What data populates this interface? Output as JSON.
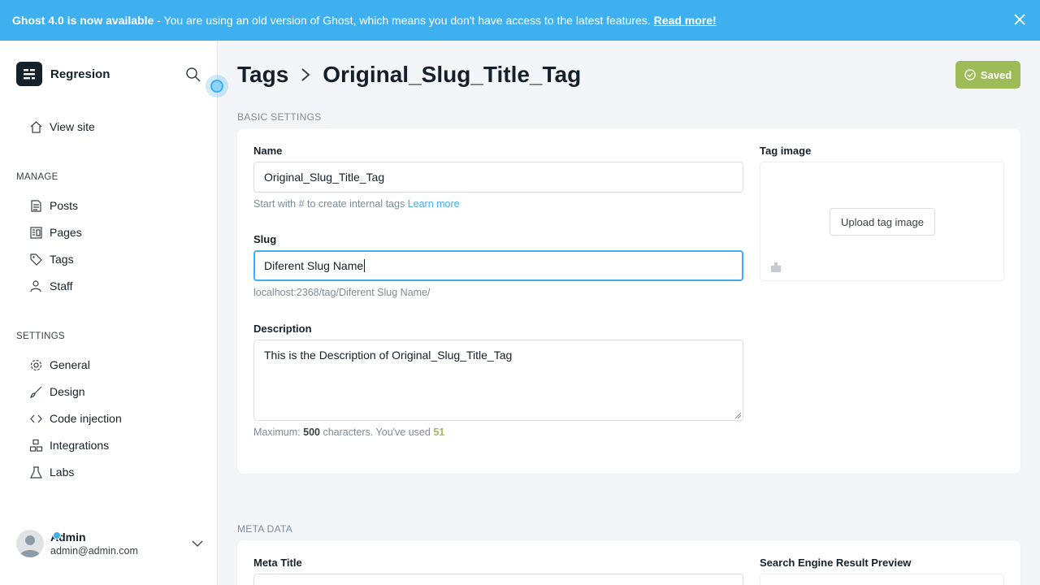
{
  "banner": {
    "title": "Ghost 4.0 is now available",
    "message": "- You are using an old version of Ghost, which means you don't have access to the latest features.",
    "link": "Read more!"
  },
  "sidebar": {
    "site_name": "Regresion",
    "view_site": "View site",
    "manage_heading": "MANAGE",
    "manage_items": [
      "Posts",
      "Pages",
      "Tags",
      "Staff"
    ],
    "settings_heading": "SETTINGS",
    "settings_items": [
      "General",
      "Design",
      "Code injection",
      "Integrations",
      "Labs"
    ],
    "user": {
      "name": "Admin",
      "email": "admin@admin.com"
    }
  },
  "header": {
    "breadcrumb_parent": "Tags",
    "breadcrumb_current": "Original_Slug_Title_Tag",
    "saved_label": "Saved"
  },
  "basic_settings": {
    "section_title": "BASIC SETTINGS",
    "name_label": "Name",
    "name_value": "Original_Slug_Title_Tag",
    "name_hint": "Start with # to create internal tags",
    "name_hint_link": "Learn more",
    "slug_label": "Slug",
    "slug_value": "Diferent Slug Name",
    "slug_url": "localhost:2368/tag/Diferent Slug Name/",
    "description_label": "Description",
    "description_value": "This is  the Description of Original_Slug_Title_Tag",
    "desc_hint_prefix": "Maximum:",
    "desc_max": "500",
    "desc_hint_mid": "characters. You've used",
    "desc_used": "51",
    "tag_image_label": "Tag image",
    "upload_label": "Upload tag image"
  },
  "meta_data": {
    "section_title": "META DATA",
    "meta_title_label": "Meta Title",
    "preview_label": "Search Engine Result Preview"
  },
  "colors": {
    "banner": "#3eb0ef",
    "saved": "#9fbb58",
    "focus": "#3eb0ef"
  }
}
